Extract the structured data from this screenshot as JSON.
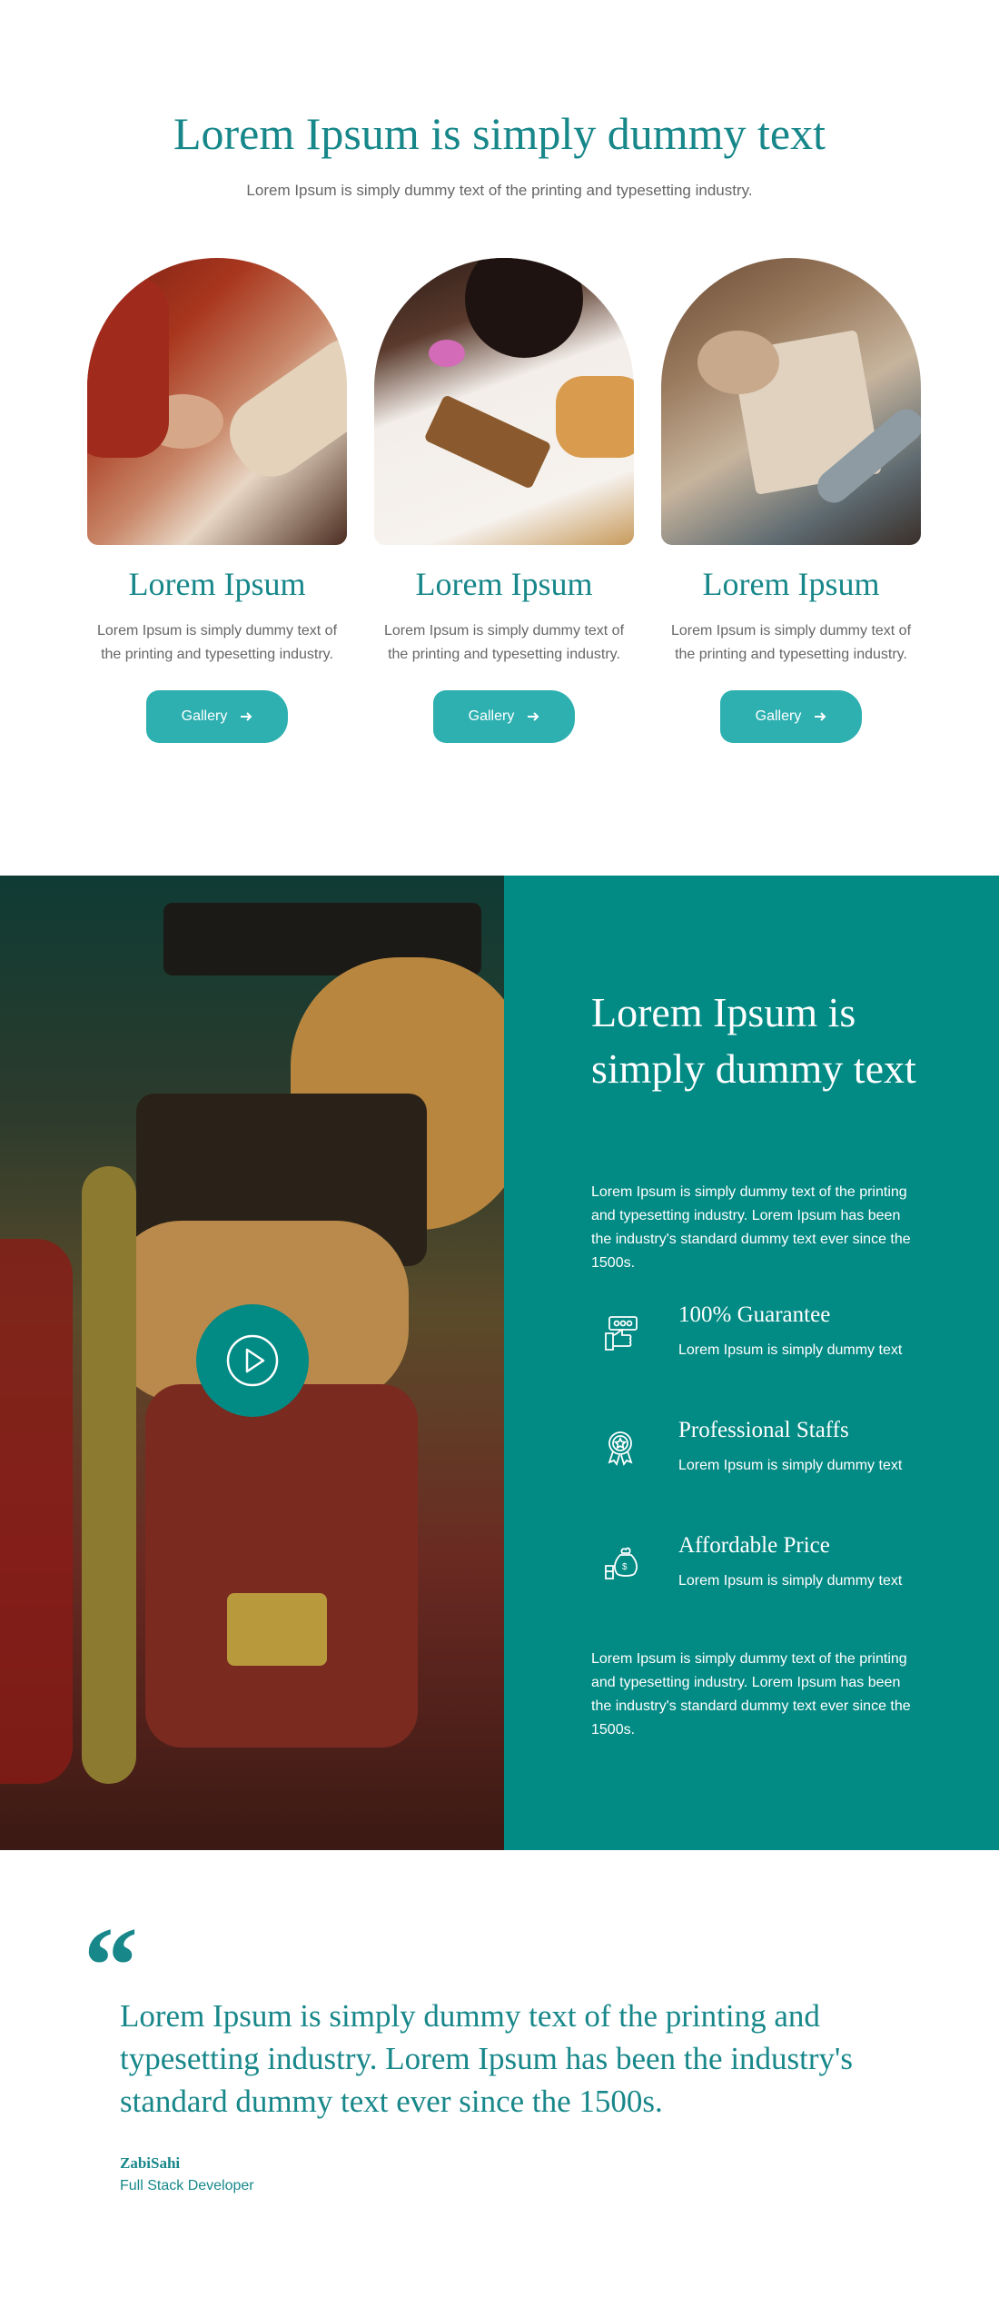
{
  "intro": {
    "title": "Lorem Ipsum is simply dummy text",
    "subtitle": "Lorem Ipsum is simply dummy text of the printing and typesetting industry."
  },
  "cards": [
    {
      "title": "Lorem Ipsum",
      "text": "Lorem Ipsum is simply dummy text of the printing and typesetting industry.",
      "button": "Gallery",
      "icon": "arrow-right-icon"
    },
    {
      "title": "Lorem Ipsum",
      "text": "Lorem Ipsum is simply dummy text of the printing and typesetting industry.",
      "button": "Gallery",
      "icon": "arrow-right-icon"
    },
    {
      "title": "Lorem Ipsum",
      "text": "Lorem Ipsum is simply dummy text of the printing and typesetting industry.",
      "button": "Gallery",
      "icon": "arrow-right-icon"
    }
  ],
  "feature": {
    "title": "Lorem Ipsum is simply dummy text",
    "intro": "Lorem Ipsum is simply dummy text of the printing and typesetting industry. Lorem Ipsum has been the industry's standard dummy text ever since the 1500s.",
    "items": [
      {
        "title": "100% Guarantee",
        "text": "Lorem Ipsum is simply dummy text",
        "icon": "guarantee-icon"
      },
      {
        "title": "Professional Staffs",
        "text": "Lorem Ipsum is simply dummy text",
        "icon": "award-badge-icon"
      },
      {
        "title": "Affordable Price",
        "text": "Lorem Ipsum is simply dummy text",
        "icon": "money-bag-icon"
      }
    ],
    "outro": "Lorem Ipsum is simply dummy text of the printing and typesetting industry. Lorem Ipsum has been the industry's standard dummy text ever since the 1500s.",
    "play_icon": "play-icon"
  },
  "testimonial": {
    "quote_mark": "“",
    "text": "Lorem Ipsum is simply dummy text of the printing and typesetting industry. Lorem Ipsum has been the industry's standard dummy text ever since the 1500s.",
    "author": "ZabiSahi",
    "role": "Full Stack Developer"
  },
  "colors": {
    "accent": "#17878a",
    "panel": "#028a84",
    "button": "#2eb0b1"
  }
}
